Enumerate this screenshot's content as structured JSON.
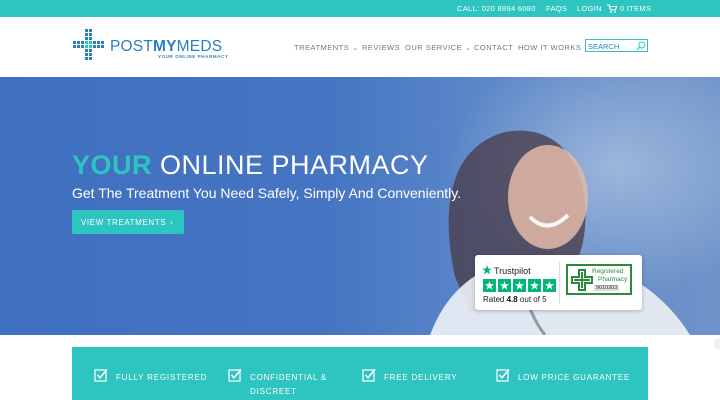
{
  "topbar": {
    "phone": "CALL: 020 8894 6080",
    "faqs": "FAQS",
    "login": "LOGIN",
    "cart": "0 ITEMS"
  },
  "logo": {
    "post": "POST",
    "my": "MY",
    "meds": "MEDS",
    "tagline": "YOUR ONLINE PHARMACY"
  },
  "nav": {
    "items": [
      {
        "label": "TREATMENTS",
        "dropdown": true
      },
      {
        "label": "REVIEWS",
        "dropdown": false
      },
      {
        "label": "OUR SERVICE",
        "dropdown": true
      },
      {
        "label": "CONTACT",
        "dropdown": false
      },
      {
        "label": "HOW IT WORKS",
        "dropdown": false
      }
    ],
    "search_placeholder": "SEARCH"
  },
  "hero": {
    "title_accent": "YOUR",
    "title_rest": " ONLINE PHARMACY",
    "subtitle": "Get The Treatment You Need Safely, Simply And Conveniently.",
    "button": "VIEW TREATMENTS"
  },
  "trustpilot": {
    "name": "Trustpilot",
    "rating_prefix": "Rated ",
    "rating_value": "4.8",
    "rating_suffix": " out of 5",
    "stars": 5
  },
  "registered": {
    "line1": "Registered",
    "line2": "Pharmacy",
    "number": "9010203"
  },
  "features": [
    {
      "line1": "FULLY REGISTERED",
      "line2": ""
    },
    {
      "line1": "CONFIDENTIAL &",
      "line2": "DISCREET"
    },
    {
      "line1": "FREE DELIVERY",
      "line2": ""
    },
    {
      "line1": "LOW PRICE GUARANTEE",
      "line2": ""
    }
  ],
  "colors": {
    "teal": "#2ec4c0",
    "blue": "#2a7fbf",
    "hero_bg": "#4575c2",
    "trustpilot_green": "#00b67a",
    "pharmacy_green": "#2e8b3a"
  }
}
